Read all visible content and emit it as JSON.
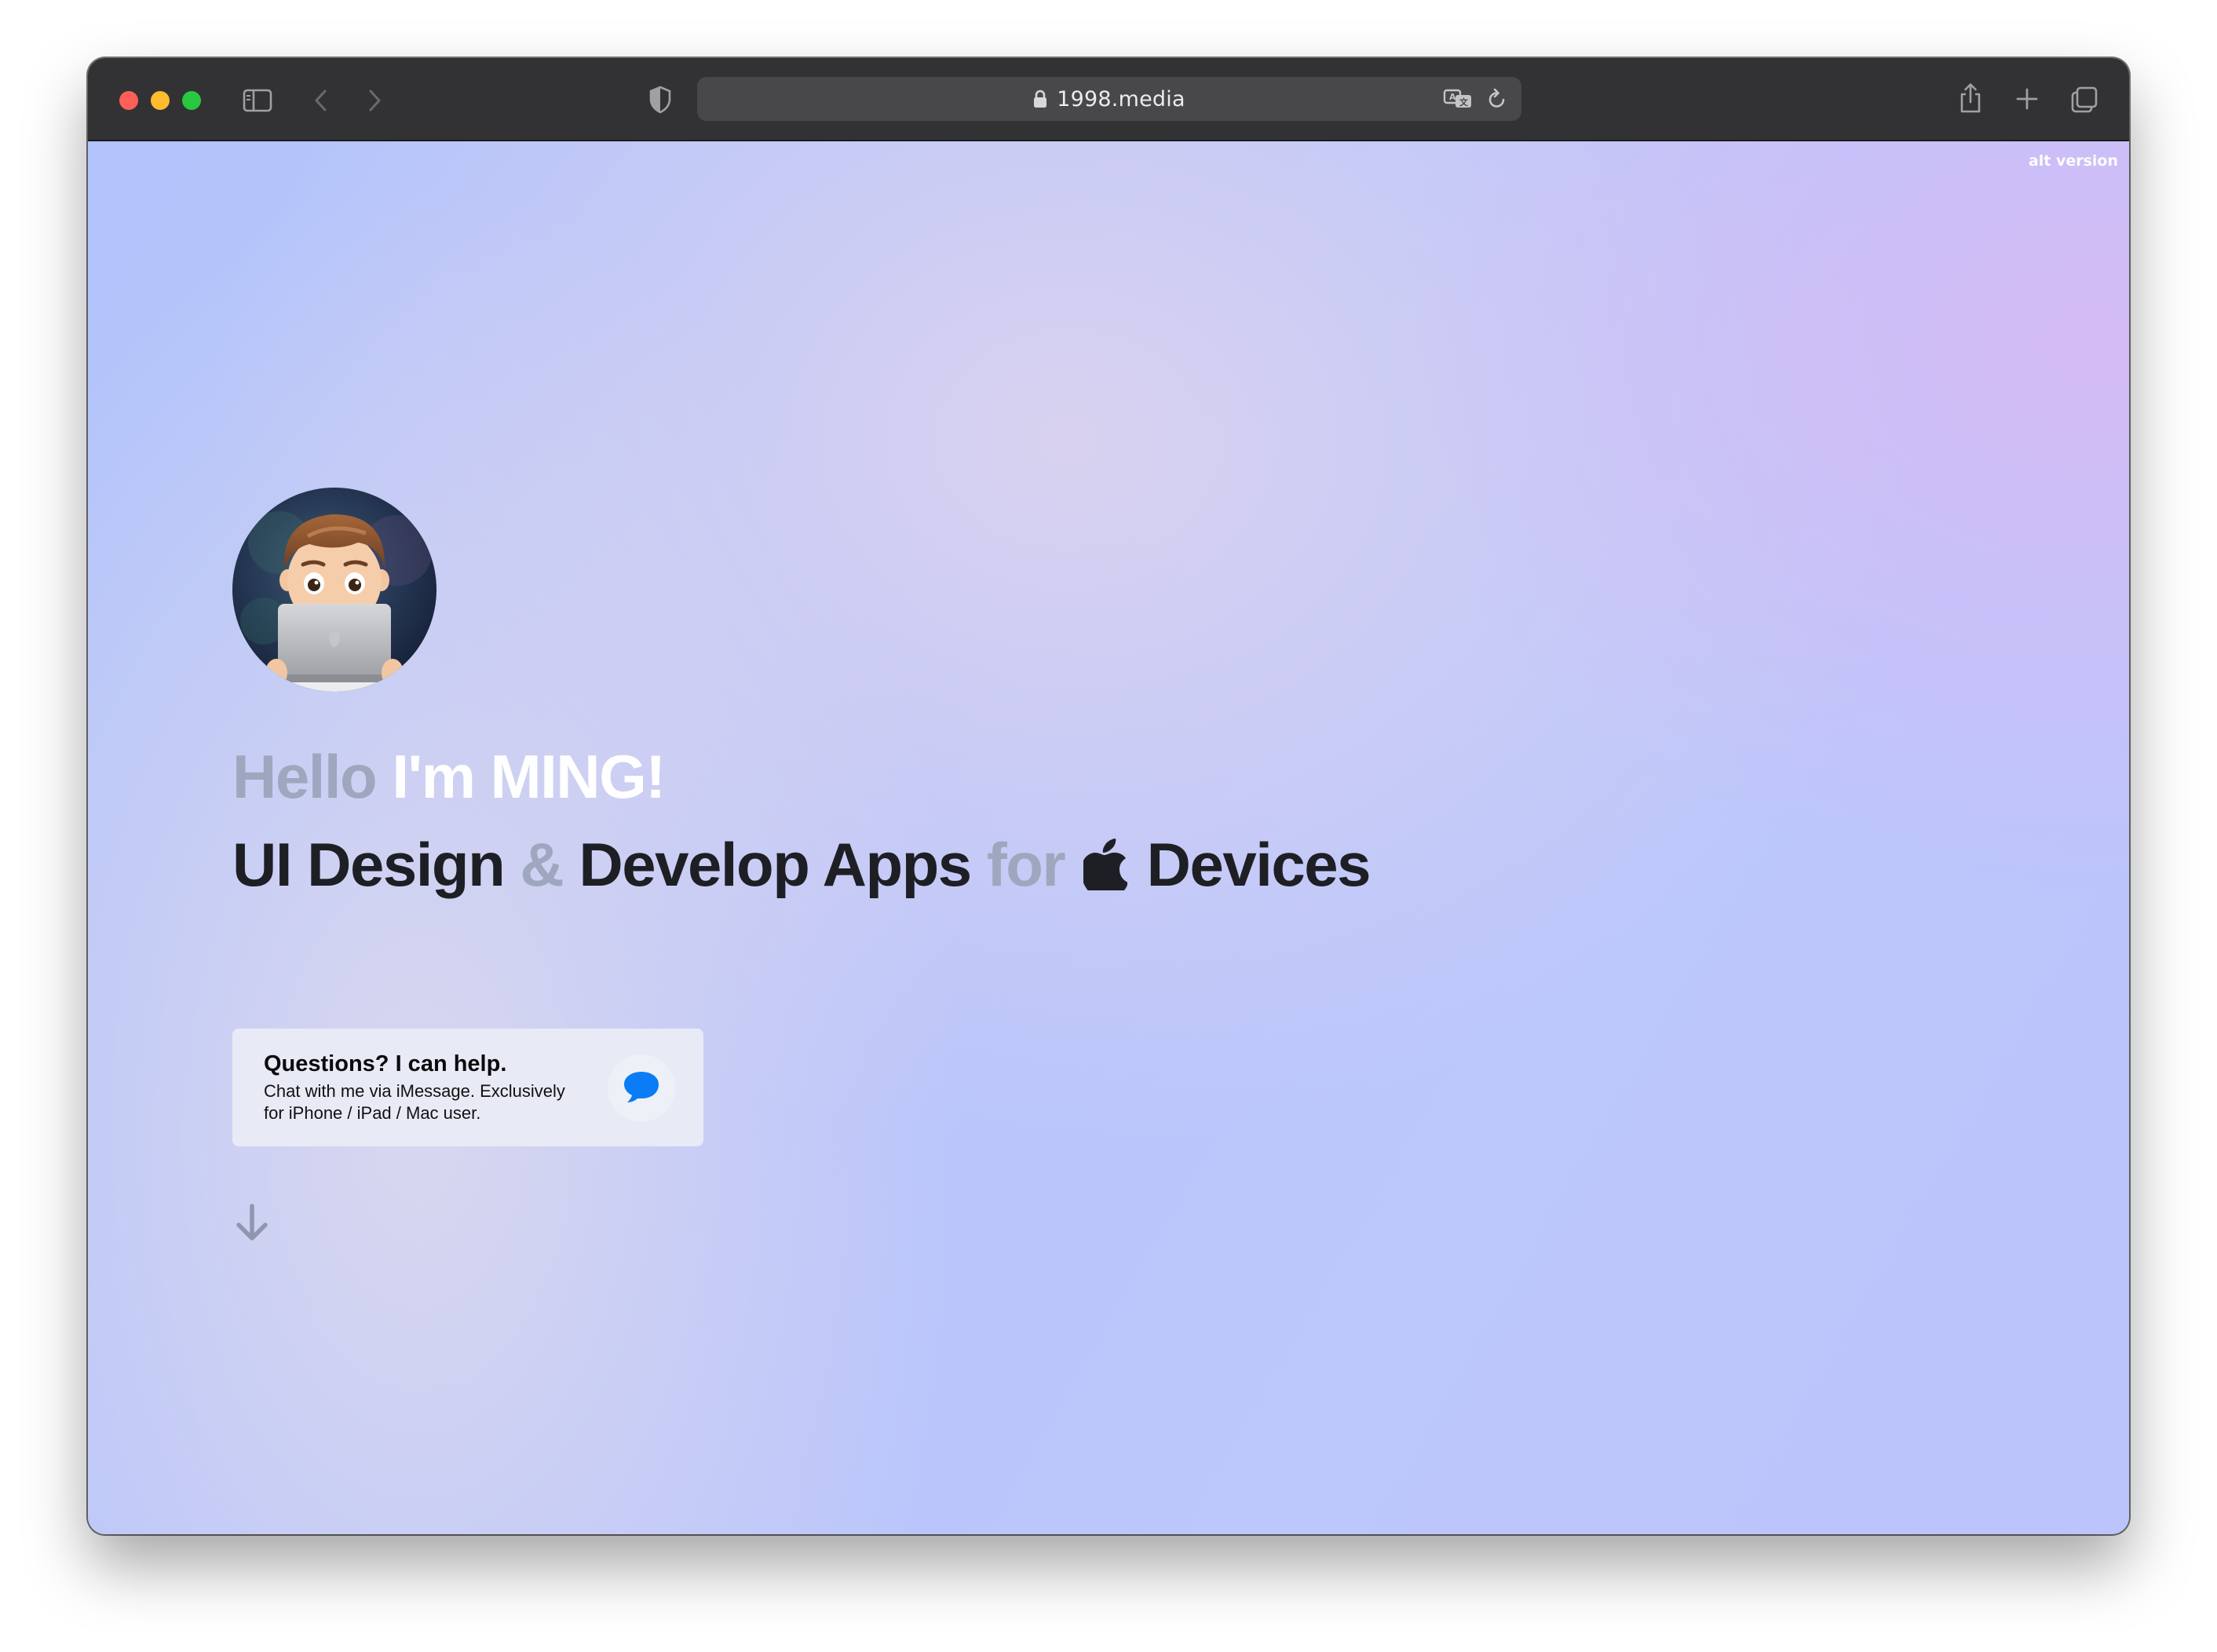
{
  "browser": {
    "url": "1998.media",
    "icons": {
      "sidebar": "sidebar-icon",
      "back": "chevron-left-icon",
      "forward": "chevron-right-icon",
      "privacy": "shield-icon",
      "lock": "lock-icon",
      "translate": "translate-icon",
      "reload": "reload-icon",
      "share": "share-icon",
      "new_tab": "plus-icon",
      "tabs": "tab-overview-icon"
    }
  },
  "page": {
    "alt_link": "alt version",
    "hero": {
      "greeting_word": "Hello",
      "greeting_name": "I'm MING!",
      "line2_part1": "UI Design",
      "line2_amp": "&",
      "line2_part2": "Develop Apps",
      "line2_for": "for",
      "line2_part3": "Devices",
      "apple_icon": "apple-logo-icon"
    },
    "help_card": {
      "title": "Questions? I can help.",
      "body": "Chat with me via iMessage. Exclusively for iPhone / iPad / Mac user.",
      "icon": "message-bubble-icon"
    },
    "scroll_icon": "arrow-down-icon"
  },
  "colors": {
    "toolbar": "#323234",
    "address_bar": "#48484b",
    "hero_dark": "#1e1f24",
    "hero_muted": "#9ea7bd",
    "imessage_blue": "#0a7cf5",
    "card_bg": "#e8eaf6"
  }
}
